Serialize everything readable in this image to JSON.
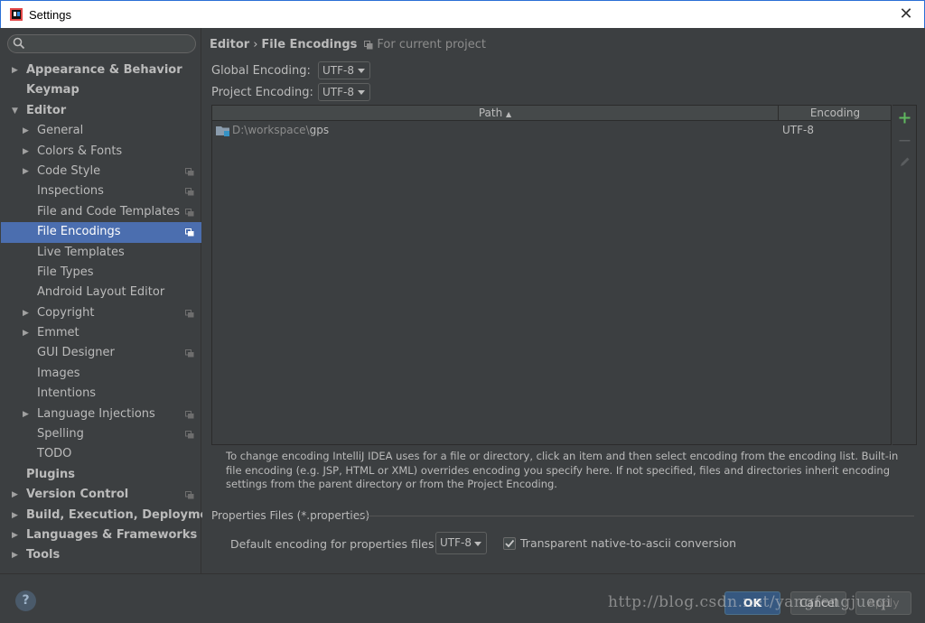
{
  "window": {
    "title": "Settings"
  },
  "search": {
    "placeholder": ""
  },
  "sidebar": {
    "items": [
      {
        "label": "Appearance & Behavior",
        "level": 0,
        "arrow": "right",
        "bold": true,
        "project": false
      },
      {
        "label": "Keymap",
        "level": 0,
        "arrow": "",
        "bold": true,
        "project": false
      },
      {
        "label": "Editor",
        "level": 0,
        "arrow": "down",
        "bold": true,
        "project": false
      },
      {
        "label": "General",
        "level": 1,
        "arrow": "right",
        "bold": false,
        "project": false
      },
      {
        "label": "Colors & Fonts",
        "level": 1,
        "arrow": "right",
        "bold": false,
        "project": false
      },
      {
        "label": "Code Style",
        "level": 1,
        "arrow": "right",
        "bold": false,
        "project": true
      },
      {
        "label": "Inspections",
        "level": 1,
        "arrow": "",
        "bold": false,
        "project": true
      },
      {
        "label": "File and Code Templates",
        "level": 1,
        "arrow": "",
        "bold": false,
        "project": true
      },
      {
        "label": "File Encodings",
        "level": 1,
        "arrow": "",
        "bold": false,
        "project": true,
        "selected": true
      },
      {
        "label": "Live Templates",
        "level": 1,
        "arrow": "",
        "bold": false,
        "project": false
      },
      {
        "label": "File Types",
        "level": 1,
        "arrow": "",
        "bold": false,
        "project": false
      },
      {
        "label": "Android Layout Editor",
        "level": 1,
        "arrow": "",
        "bold": false,
        "project": false
      },
      {
        "label": "Copyright",
        "level": 1,
        "arrow": "right",
        "bold": false,
        "project": true
      },
      {
        "label": "Emmet",
        "level": 1,
        "arrow": "right",
        "bold": false,
        "project": false
      },
      {
        "label": "GUI Designer",
        "level": 1,
        "arrow": "",
        "bold": false,
        "project": true
      },
      {
        "label": "Images",
        "level": 1,
        "arrow": "",
        "bold": false,
        "project": false
      },
      {
        "label": "Intentions",
        "level": 1,
        "arrow": "",
        "bold": false,
        "project": false
      },
      {
        "label": "Language Injections",
        "level": 1,
        "arrow": "right",
        "bold": false,
        "project": true
      },
      {
        "label": "Spelling",
        "level": 1,
        "arrow": "",
        "bold": false,
        "project": true
      },
      {
        "label": "TODO",
        "level": 1,
        "arrow": "",
        "bold": false,
        "project": false
      },
      {
        "label": "Plugins",
        "level": 0,
        "arrow": "",
        "bold": true,
        "project": false
      },
      {
        "label": "Version Control",
        "level": 0,
        "arrow": "right",
        "bold": true,
        "project": true
      },
      {
        "label": "Build, Execution, Deployment",
        "level": 0,
        "arrow": "right",
        "bold": true,
        "project": false
      },
      {
        "label": "Languages & Frameworks",
        "level": 0,
        "arrow": "right",
        "bold": true,
        "project": false
      },
      {
        "label": "Tools",
        "level": 0,
        "arrow": "right",
        "bold": true,
        "project": false
      }
    ]
  },
  "breadcrumb": {
    "parent": "Editor",
    "separator": "›",
    "current": "File Encodings",
    "hint": "For current project"
  },
  "global_encoding": {
    "label": "Global Encoding:",
    "value": "UTF-8"
  },
  "project_encoding": {
    "label": "Project Encoding:",
    "value": "UTF-8"
  },
  "table": {
    "columns": {
      "path": "Path",
      "sort_indicator": "▲",
      "encoding": "Encoding"
    },
    "rows": [
      {
        "path_dim": "D:\\workspace\\",
        "path_strong": "gps",
        "encoding": "UTF-8"
      }
    ]
  },
  "toolbar": {
    "add_icon": "plus-icon",
    "remove_icon": "minus-icon",
    "edit_icon": "pencil-icon"
  },
  "description": "To change encoding IntelliJ IDEA uses for a file or directory, click an item and then select encoding from the encoding list. Built-in file encoding (e.g. JSP, HTML or XML) overrides encoding you specify here. If not specified, files and directories inherit encoding settings from the parent directory or from the Project Encoding.",
  "properties": {
    "section_title": "Properties Files (*.properties)",
    "default_label": "Default encoding for properties files:",
    "default_value": "UTF-8",
    "native_to_ascii_label": "Transparent native-to-ascii conversion",
    "native_to_ascii_checked": true
  },
  "footer": {
    "help": "?",
    "ok": "OK",
    "cancel": "Cancel",
    "apply": "Apply",
    "watermark": "http://blog.csdn.net/yangfengjueqi"
  },
  "colors": {
    "selection": "#4b6eaf",
    "background": "#3c3f41",
    "accent_add": "#5fb85f"
  }
}
